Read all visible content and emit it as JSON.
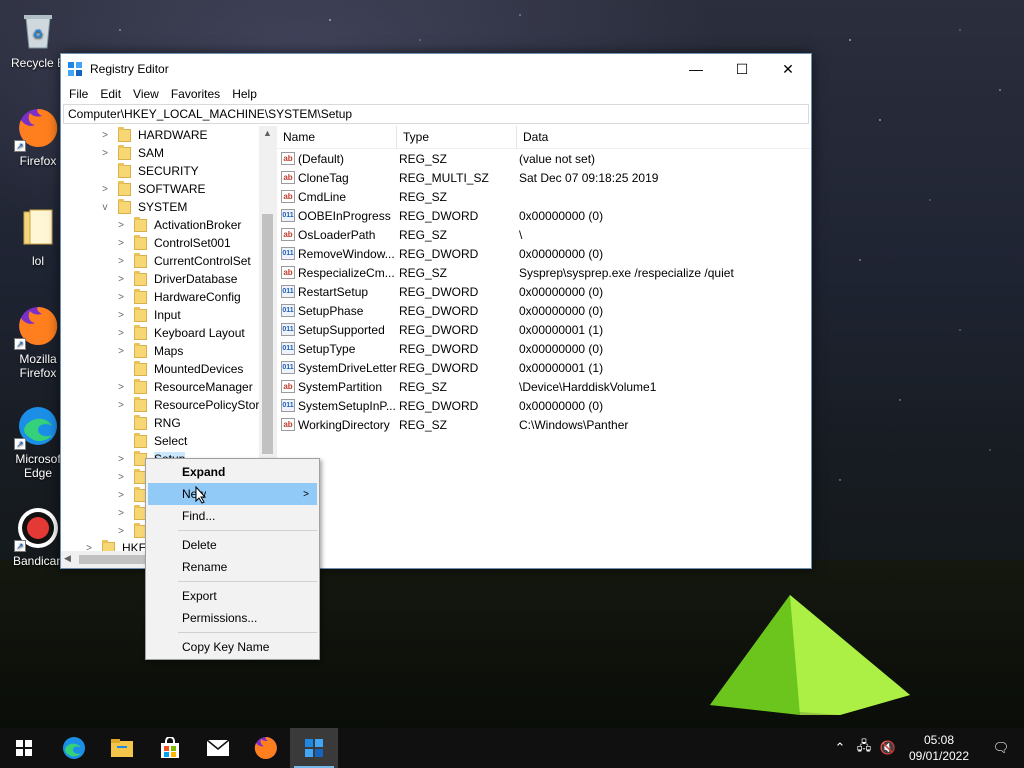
{
  "desktop": {
    "icons": [
      {
        "label": "Recycle B"
      },
      {
        "label": "Firefox"
      },
      {
        "label": "lol"
      },
      {
        "label": "Mozilla Firefox"
      },
      {
        "label": "Microsof Edge"
      },
      {
        "label": "Bandican"
      }
    ]
  },
  "window": {
    "title": "Registry Editor",
    "menu": [
      "File",
      "Edit",
      "View",
      "Favorites",
      "Help"
    ],
    "address": "Computer\\HKEY_LOCAL_MACHINE\\SYSTEM\\Setup"
  },
  "tree": {
    "items": [
      {
        "label": "HARDWARE",
        "level": 1,
        "expander": ">"
      },
      {
        "label": "SAM",
        "level": 1,
        "expander": ">"
      },
      {
        "label": "SECURITY",
        "level": 1,
        "expander": ""
      },
      {
        "label": "SOFTWARE",
        "level": 1,
        "expander": ">"
      },
      {
        "label": "SYSTEM",
        "level": 1,
        "expander": "v"
      },
      {
        "label": "ActivationBroker",
        "level": 2,
        "expander": ">"
      },
      {
        "label": "ControlSet001",
        "level": 2,
        "expander": ">"
      },
      {
        "label": "CurrentControlSet",
        "level": 2,
        "expander": ">"
      },
      {
        "label": "DriverDatabase",
        "level": 2,
        "expander": ">"
      },
      {
        "label": "HardwareConfig",
        "level": 2,
        "expander": ">"
      },
      {
        "label": "Input",
        "level": 2,
        "expander": ">"
      },
      {
        "label": "Keyboard Layout",
        "level": 2,
        "expander": ">"
      },
      {
        "label": "Maps",
        "level": 2,
        "expander": ">"
      },
      {
        "label": "MountedDevices",
        "level": 2,
        "expander": ""
      },
      {
        "label": "ResourceManager",
        "level": 2,
        "expander": ">"
      },
      {
        "label": "ResourcePolicyStore",
        "level": 2,
        "expander": ">"
      },
      {
        "label": "RNG",
        "level": 2,
        "expander": ""
      },
      {
        "label": "Select",
        "level": 2,
        "expander": ""
      },
      {
        "label": "Setup",
        "level": 2,
        "expander": ">"
      },
      {
        "label": "",
        "level": 2,
        "expander": ">"
      },
      {
        "label": "",
        "level": 2,
        "expander": ">"
      },
      {
        "label": "",
        "level": 2,
        "expander": ">"
      },
      {
        "label": "",
        "level": 2,
        "expander": ">"
      },
      {
        "label": "HKEY",
        "level": 0,
        "expander": ">"
      }
    ]
  },
  "list": {
    "headers": {
      "name": "Name",
      "type": "Type",
      "data": "Data"
    },
    "rows": [
      {
        "name": "(Default)",
        "type": "REG_SZ",
        "data": "(value not set)",
        "icon": "ab"
      },
      {
        "name": "CloneTag",
        "type": "REG_MULTI_SZ",
        "data": "Sat Dec 07 09:18:25 2019",
        "icon": "ab"
      },
      {
        "name": "CmdLine",
        "type": "REG_SZ",
        "data": "",
        "icon": "ab"
      },
      {
        "name": "OOBEInProgress",
        "type": "REG_DWORD",
        "data": "0x00000000 (0)",
        "icon": "bin"
      },
      {
        "name": "OsLoaderPath",
        "type": "REG_SZ",
        "data": "\\",
        "icon": "ab"
      },
      {
        "name": "RemoveWindow...",
        "type": "REG_DWORD",
        "data": "0x00000000 (0)",
        "icon": "bin"
      },
      {
        "name": "RespecializeCm...",
        "type": "REG_SZ",
        "data": "Sysprep\\sysprep.exe /respecialize /quiet",
        "icon": "ab"
      },
      {
        "name": "RestartSetup",
        "type": "REG_DWORD",
        "data": "0x00000000 (0)",
        "icon": "bin"
      },
      {
        "name": "SetupPhase",
        "type": "REG_DWORD",
        "data": "0x00000000 (0)",
        "icon": "bin"
      },
      {
        "name": "SetupSupported",
        "type": "REG_DWORD",
        "data": "0x00000001 (1)",
        "icon": "bin"
      },
      {
        "name": "SetupType",
        "type": "REG_DWORD",
        "data": "0x00000000 (0)",
        "icon": "bin"
      },
      {
        "name": "SystemDriveLetter",
        "type": "REG_DWORD",
        "data": "0x00000001 (1)",
        "icon": "bin"
      },
      {
        "name": "SystemPartition",
        "type": "REG_SZ",
        "data": "\\Device\\HarddiskVolume1",
        "icon": "ab"
      },
      {
        "name": "SystemSetupInP...",
        "type": "REG_DWORD",
        "data": "0x00000000 (0)",
        "icon": "bin"
      },
      {
        "name": "WorkingDirectory",
        "type": "REG_SZ",
        "data": "C:\\Windows\\Panther",
        "icon": "ab"
      }
    ]
  },
  "context_menu": {
    "expand": "Expand",
    "new": "New",
    "find": "Find...",
    "delete": "Delete",
    "rename": "Rename",
    "export": "Export",
    "permissions": "Permissions...",
    "copy_key_name": "Copy Key Name",
    "submenu_arrow": ">"
  },
  "taskbar": {
    "time": "05:08",
    "date": "09/01/2022"
  },
  "colors": {
    "selection": "#91c9f7",
    "taskbar": "#101010",
    "accent": "#76b9ed"
  }
}
